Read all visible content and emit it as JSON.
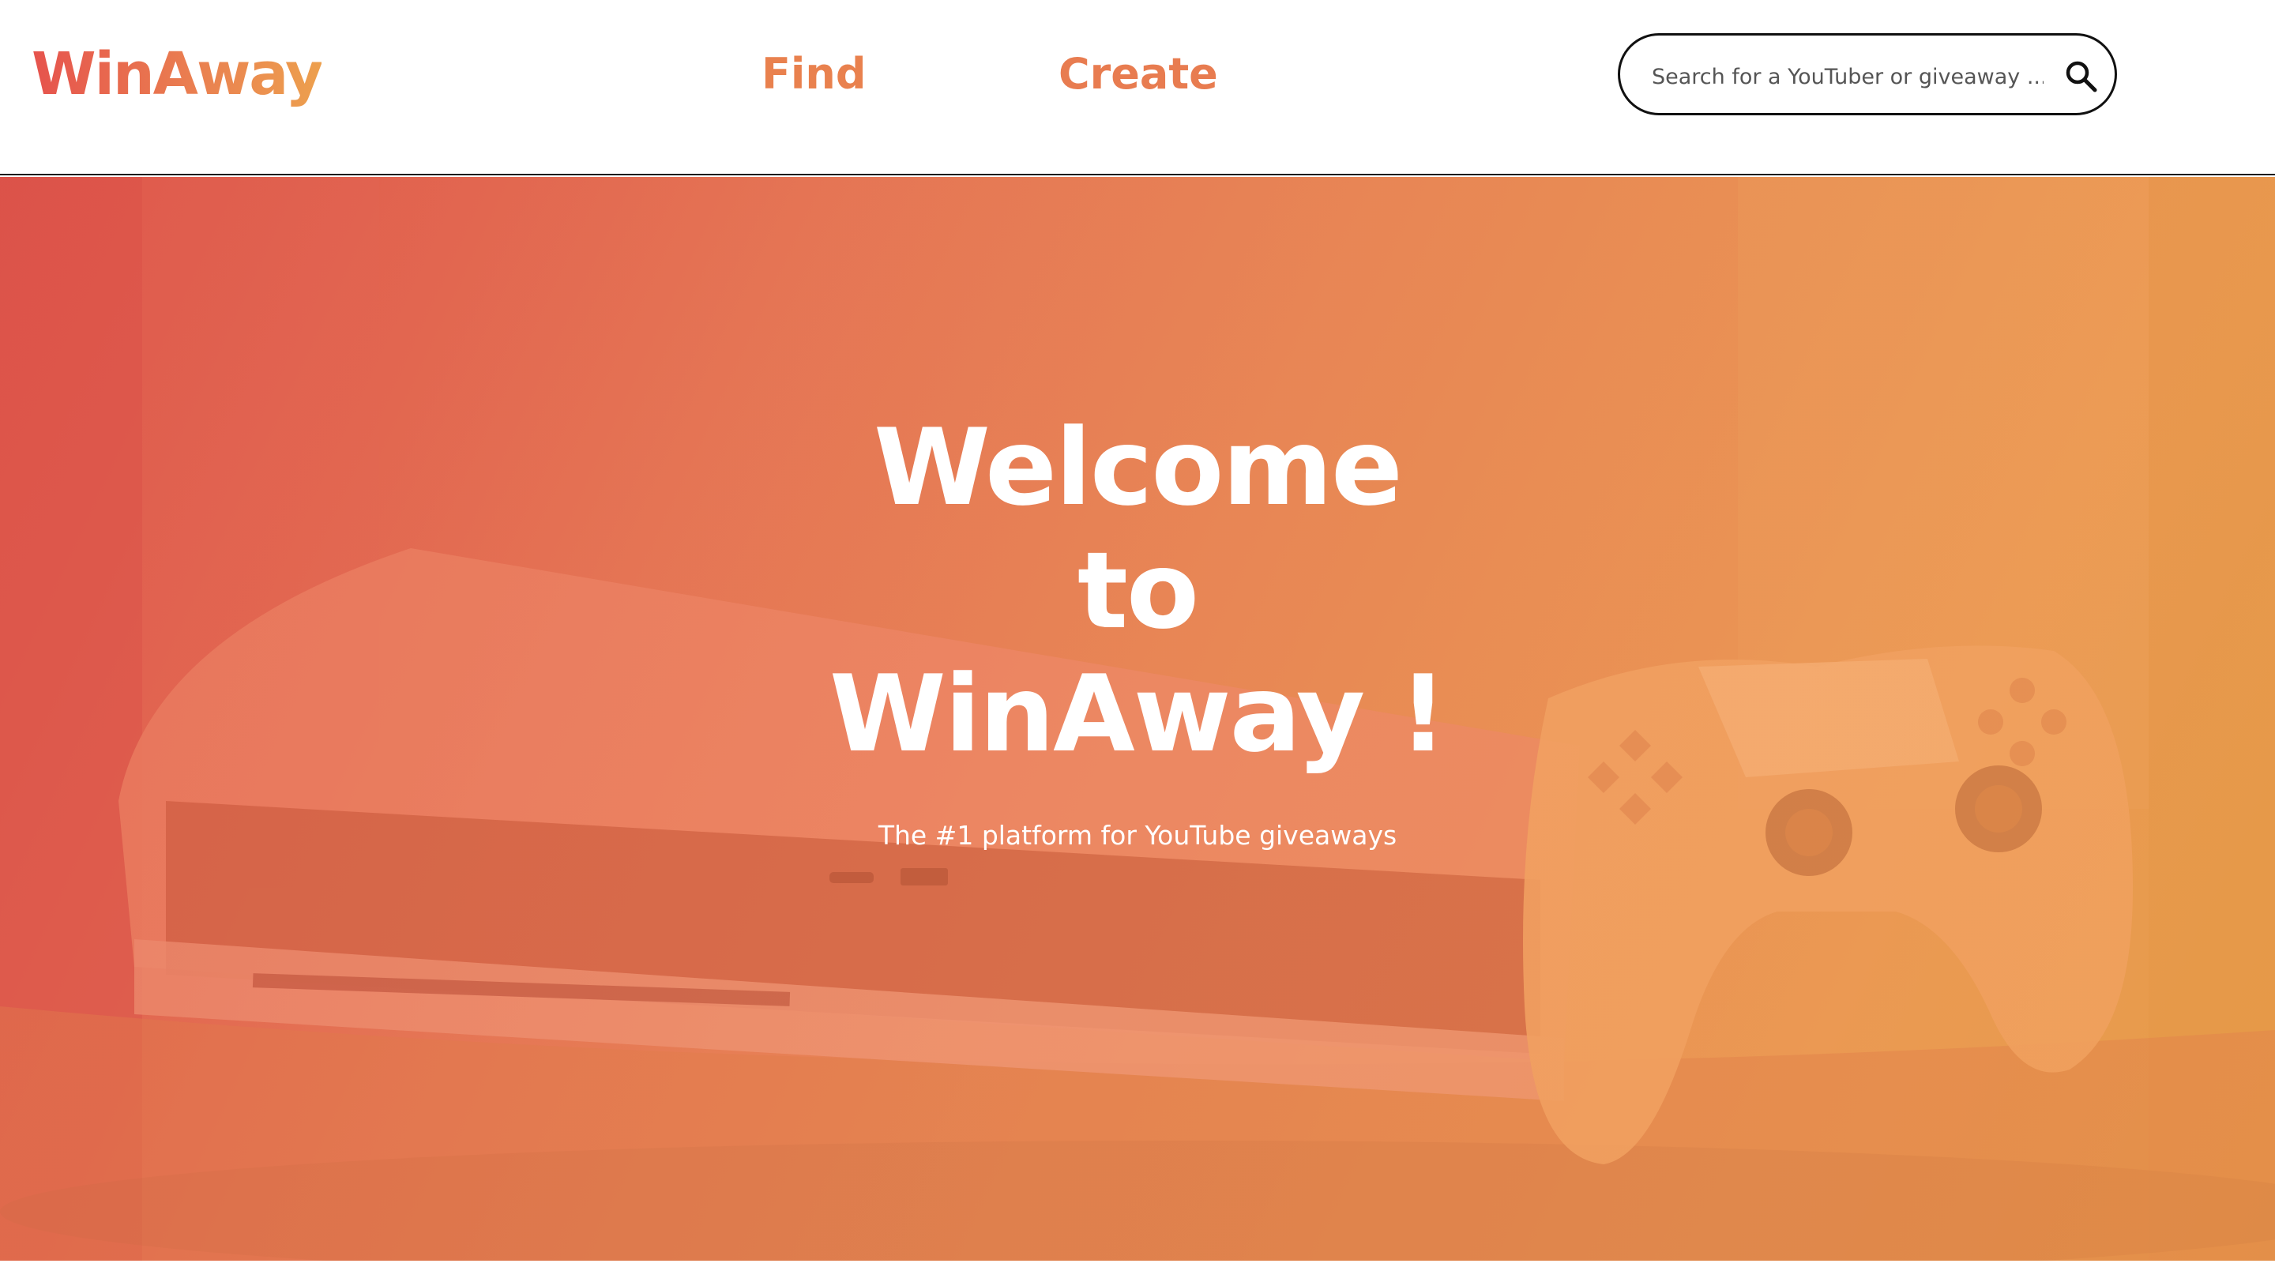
{
  "header": {
    "logo": "WinAway",
    "nav": [
      {
        "label": "Find"
      },
      {
        "label": "Create"
      }
    ],
    "search": {
      "placeholder": "Search for a YouTuber or giveaway ...",
      "icon": "search-icon"
    }
  },
  "hero": {
    "title_lines": [
      "Welcome",
      "to",
      "WinAway !"
    ],
    "subtitle": "The #1 platform for YouTube giveaways",
    "background_image": "game console with controller under orange gradient overlay"
  },
  "colors": {
    "brand_gradient_start": "#e6534d",
    "brand_gradient_end": "#eda04e",
    "nav_accent": "#e9814e",
    "hero_text": "#ffffff",
    "header_bg": "#ffffff"
  }
}
